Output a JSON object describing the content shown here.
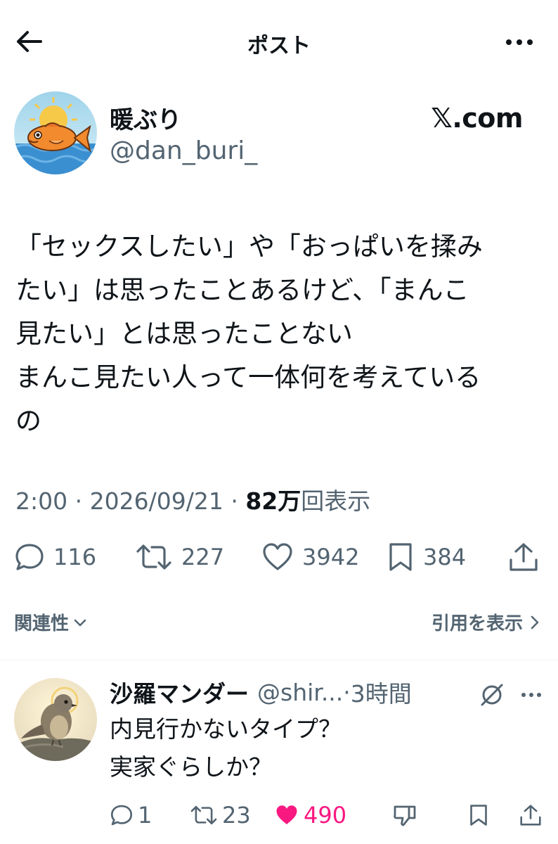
{
  "header": {
    "title": "ポスト",
    "back_icon": "arrow-left-icon",
    "more_icon": "more-horizontal-icon"
  },
  "post": {
    "author_name": "暖ぶり",
    "author_handle": "@dan_buri_",
    "watermark": "𝕏.com",
    "avatar_icon": "fish-with-sun-avatar",
    "body_lines": [
      "「セックスしたい」や「おっぱいを揉み",
      "たい」は思ったことあるけど、「まんこ",
      "見たい」とは思ったことない",
      "まんこ見たい人って一体何を考えている",
      "の"
    ],
    "time": "2:00",
    "date": "2026/09/21",
    "views_count": "82万",
    "views_label": "回表示",
    "separator": "·",
    "stats": {
      "replies": "116",
      "reposts": "227",
      "likes": "3942",
      "bookmarks": "384"
    }
  },
  "sort": {
    "related_label": "関連性",
    "quotes_label": "引用を表示"
  },
  "reply": {
    "author_name": "沙羅マンダー",
    "author_handle": "@shir...",
    "separator": "·",
    "time_ago": "3時間",
    "avatar_icon": "bird-on-rock-avatar",
    "body_lines": [
      "内見行かないタイプ？",
      "実家ぐらしか？"
    ],
    "stats": {
      "replies": "1",
      "reposts": "23",
      "likes": "490"
    }
  },
  "colors": {
    "text_primary": "#0f1419",
    "text_secondary": "#536471",
    "like_pink": "#f91880",
    "divider": "#eff3f4"
  }
}
